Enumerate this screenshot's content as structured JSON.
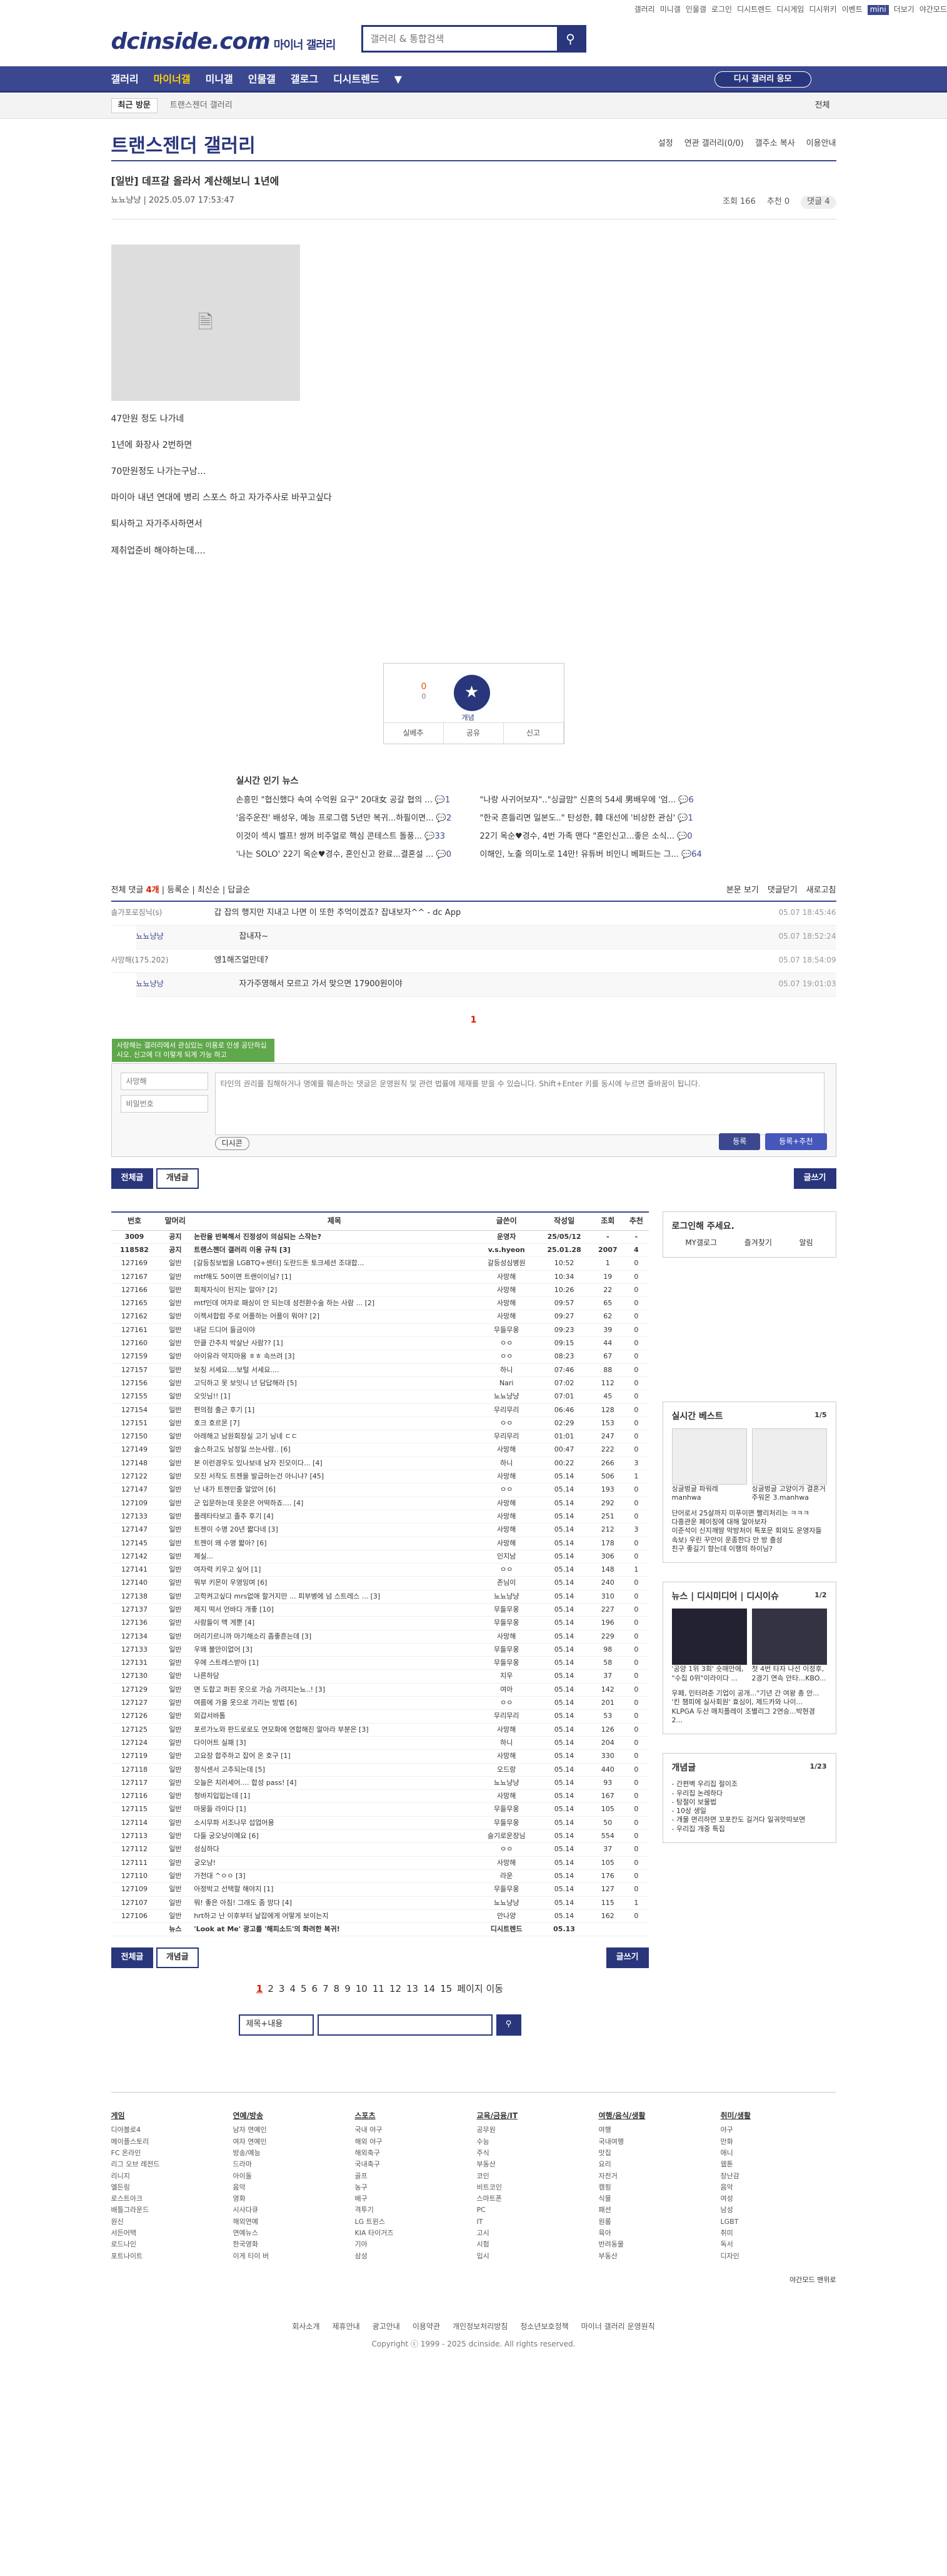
{
  "util": {
    "links": [
      "갤러리",
      "미니갤",
      "인물갤",
      "로그인",
      "디시트렌드",
      "디시게임",
      "디시위키",
      "이벤트",
      "mini",
      "더보기",
      "야간모드"
    ]
  },
  "logo": {
    "name": "dcinside.com",
    "sub": "마이너 갤러리"
  },
  "search": {
    "placeholder": "갤러리 & 통합검색"
  },
  "gnb": {
    "menu": [
      "갤러리",
      "마이너갤",
      "미니갤",
      "인물갤",
      "갤로그",
      "디시트렌드"
    ],
    "visit": "디시 갤러리 응모"
  },
  "sub": {
    "recent": "최근 방문",
    "crumb": "트랜스젠더 갤러리",
    "all": "전체"
  },
  "gallery": {
    "title": "트랜스젠더 갤러리",
    "opts": [
      "설정",
      "연관 갤러리(0/0)",
      "갤주소 복사",
      "이용안내"
    ]
  },
  "post": {
    "title": "[일반] 데프갈 올라서 계산해보니 1년에",
    "author": "뇨뇨냥냥",
    "date": "2025.05.07 17:53:47",
    "views": "조회 166",
    "rec": "추천 0",
    "comments": "댓글 4",
    "body": [
      "47만원 정도 나가네",
      "1년에 화장사 2번하면",
      "70만원정도 나가는구남...",
      "마이아 내년 연대에 병리 스포스 하고 자가주사로 바꾸고싶다",
      "퇴사하고 자가주사하면서",
      "제취업준비 해야하는데...."
    ]
  },
  "vote": {
    "up": "0",
    "up_sub": "0",
    "star": "개념",
    "acts": [
      "실베추",
      "공유",
      "신고"
    ]
  },
  "news": {
    "title": "실시간 인기 뉴스",
    "items": [
      {
        "t": "손흥민 \"협신했다 속여 수억원 요구\" 20대女 공갈 협의 ...",
        "c": "1"
      },
      {
        "t": "\"나랑 사귀어보자\"..\"싱글맘\" 신혼의 54세 男배우에 '엄...",
        "c": "6"
      },
      {
        "t": "'음주운전' 배성우, 예능 프로그램 5년만 복귀...하필이면...",
        "c": "2"
      },
      {
        "t": "\"한국 흔들리면 일본도..\" 탄성한, 韓 대선에 '비상한 관심'",
        "c": "1"
      },
      {
        "t": "이것이 섹시 벨프! 쌍꺼 비주얼로 핵심 콘테스트 돌풍...",
        "c": "33"
      },
      {
        "t": "22기 옥순♥경수, 4번 가족 맨다 \"혼인신고...좋은 소식...",
        "c": "0"
      },
      {
        "t": "'나는 SOLO' 22기 옥순♥경수, 혼인신고 완료...결혼설 ...",
        "c": "0"
      },
      {
        "t": "이해인, 노출 의미노로 14만! 유튜버 비인니 베퍼드는 그...",
        "c": "64"
      }
    ]
  },
  "comments": {
    "total_label": "전체 댓글",
    "count": "4개",
    "sort": [
      "등록순",
      "최신순",
      "답글순"
    ],
    "right": [
      "본문 보기",
      "댓글닫기",
      "새로고침"
    ],
    "list": [
      {
        "nick": "솔가포로짐닉(s)",
        "text": "갑 잡의 행지만 지내고 나면 이 또한 추억이겠죠? 잡내보자^^ - dc App",
        "date": "05.07 18:45:46",
        "reply": false
      },
      {
        "nick": "뇨뇨냥냥",
        "text": "잡내자~",
        "date": "05.07 18:52:24",
        "reply": true
      },
      {
        "nick": "사망해(175.202)",
        "text": "엥1해즈얼만데?",
        "date": "05.07 18:54:09",
        "reply": false
      },
      {
        "nick": "뇨뇨냥냥",
        "text": "자가주영해서 모르고 가서 맞으면 17900원이야",
        "date": "05.07 19:01:03",
        "reply": true
      }
    ]
  },
  "page_one": "1",
  "write": {
    "tip": "사랑해는 갤러리에서 관심있는 이용로 인생 공단하십시오. 신고에 더 이렇게 되게 가능 하고",
    "nick_placeholder": "사망해",
    "pw_placeholder": "비밀번호",
    "body_placeholder": "타인의 권리를 침해하거나 명예를 훼손하는 댓글은 운영원칙 및 관련 법률에 제재를 받을 수 있습니다. Shift+Enter 키를 동시에 누르면 줄바꿈이 됩니다.",
    "dcon": "디시콘",
    "submit": "등록",
    "submit2": "등록+추천"
  },
  "tabs": {
    "all": "전체글",
    "concept": "개념글",
    "write": "글쓰기"
  },
  "table": {
    "headers": [
      "번호",
      "말머리",
      "제목",
      "글쓴이",
      "작성일",
      "조회",
      "추천"
    ],
    "rows": [
      [
        "3009",
        "공지",
        "논란을 반복해서 진정성이 의심되는 스작는?",
        "운영자",
        "25/05/12",
        "-",
        "-"
      ],
      [
        "118582",
        "공지",
        "트랜스젠더 갤러리 이용 규칙 [3]",
        "v.s.hyeon",
        "25.01.28",
        "2007",
        "4"
      ],
      [
        "127169",
        "일반",
        "[갈등칭보법을 LGBTQ+센터] 도란드돈 토크세션 조대합...",
        "갈등성심병원",
        "10:52",
        "1",
        "0"
      ],
      [
        "127167",
        "일반",
        "mtf해도 50이면 트랜이이님? [1]",
        "사망해",
        "10:34",
        "19",
        "0"
      ],
      [
        "127166",
        "일반",
        "회제자식이 된지는 알아? [2]",
        "사망해",
        "10:26",
        "22",
        "0"
      ],
      [
        "127165",
        "일반",
        "mtf인데 여자로 패싱이 안 되는데 성전환수술 하는 사람 ... [2]",
        "사망해",
        "09:57",
        "65",
        "0"
      ],
      [
        "127162",
        "일반",
        "이젝셔합럼 주로 어플하는 어플이 뭐야? [2]",
        "사망해",
        "09:27",
        "62",
        "0"
      ],
      [
        "127161",
        "일반",
        "내담 드디어 들금이야",
        "무들무웅",
        "09:23",
        "39",
        "0"
      ],
      [
        "127160",
        "일반",
        "만클 간추치 박살난 사람?? [1]",
        "ㅇㅇ",
        "09:15",
        "44",
        "0"
      ],
      [
        "127159",
        "일반",
        "아이유라 약지마용 ㅎㅎ 속쓰려 [3]",
        "ㅇㅇ",
        "08:23",
        "67",
        "0"
      ],
      [
        "127157",
        "일반",
        "보징 서세요....보털 서세요....",
        "하니",
        "07:46",
        "88",
        "0"
      ],
      [
        "127156",
        "일반",
        "고딕하고 못 보잇니 넌 담답해라 [5]",
        "Nari",
        "07:02",
        "112",
        "0"
      ],
      [
        "127155",
        "일반",
        "오잇님!! [1]",
        "뇨뇨냥냥",
        "07:01",
        "45",
        "0"
      ],
      [
        "127154",
        "일반",
        "편의점 출근 후기 [1]",
        "무리무리",
        "06:46",
        "128",
        "0"
      ],
      [
        "127151",
        "일반",
        "호크 호르몬 [7]",
        "ㅇㅇ",
        "02:29",
        "153",
        "0"
      ],
      [
        "127150",
        "일반",
        "아레해고 남원회장실 고기 닝네 ㄷㄷ",
        "무리무리",
        "01:01",
        "247",
        "0"
      ],
      [
        "127149",
        "일반",
        "술스하고도 남정일 쓰는사람.. [6]",
        "사망해",
        "00:47",
        "222",
        "0"
      ],
      [
        "127148",
        "일반",
        "본 이런경우도 있나보네 남자 진모이다... [4]",
        "하니",
        "00:22",
        "266",
        "3"
      ],
      [
        "127122",
        "일반",
        "모진 서작도 트젠을 발급하는건 아니냐? [45]",
        "사망해",
        "05.14",
        "506",
        "1"
      ],
      [
        "127147",
        "일반",
        "난 내가 트젠인줄 알았어 [6]",
        "ㅇㅇ",
        "05.14",
        "193",
        "0"
      ],
      [
        "127109",
        "일반",
        "군 입문하는데 옷운은 어떡하죠.... [4]",
        "사망해",
        "05.14",
        "292",
        "0"
      ],
      [
        "127133",
        "일반",
        "플레타타보고 졸추 후기 [4]",
        "사망해",
        "05.14",
        "251",
        "0"
      ],
      [
        "127147",
        "일반",
        "트젠이 수명 20년 짧다네 [3]",
        "사망해",
        "05.14",
        "212",
        "3"
      ],
      [
        "127145",
        "일반",
        "트젠이 왜 수명 짧아? [6]",
        "사망해",
        "05.14",
        "178",
        "0"
      ],
      [
        "127142",
        "일반",
        "제실...",
        "인지남",
        "05.14",
        "306",
        "0"
      ],
      [
        "127141",
        "일반",
        "여자력 키우고 싶어 [1]",
        "ㅇㅇ",
        "05.14",
        "148",
        "1"
      ],
      [
        "127140",
        "일반",
        "뭐부 키몬이 우영잉며 [6]",
        "존님이",
        "05.14",
        "240",
        "0"
      ],
      [
        "127138",
        "일반",
        "고학켜고싶다 mrs없애 할거지만 ... 피부병에 넘 스트레스 ... [3]",
        "뇨뇨냥냥",
        "05.14",
        "310",
        "0"
      ],
      [
        "127137",
        "일반",
        "제지 떡서 언바다 개좋 [10]",
        "무들무웅",
        "05.14",
        "227",
        "0"
      ],
      [
        "127136",
        "일반",
        "사람들이 맥 게뿐 [4]",
        "무들무웅",
        "05.14",
        "196",
        "0"
      ],
      [
        "127134",
        "일반",
        "머리기르니까 마기해소리 좀좋흔는데 [3]",
        "사망해",
        "05.14",
        "229",
        "0"
      ],
      [
        "127133",
        "일반",
        "우왜 불안이없어 [3]",
        "무들무웅",
        "05.14",
        "98",
        "0"
      ],
      [
        "127131",
        "일반",
        "우에 스트레스받아 [1]",
        "무들무웅",
        "05.14",
        "58",
        "0"
      ],
      [
        "127130",
        "일반",
        "나른하당",
        "지우",
        "05.14",
        "37",
        "0"
      ],
      [
        "127129",
        "일반",
        "면 도합고 퍼핀 옷으로 가슴 가려지는뇨..! [3]",
        "여아",
        "05.14",
        "142",
        "0"
      ],
      [
        "127127",
        "일반",
        "여름에 가을 옷으로 가리는 방법 [6]",
        "ㅇㅇ",
        "05.14",
        "201",
        "0"
      ],
      [
        "127126",
        "일반",
        "외갑서바톰",
        "무리무리",
        "05.14",
        "53",
        "0"
      ],
      [
        "127125",
        "일반",
        "포르가노와 판드로로도 연모화에 연합해진 알아라 부분은 [3]",
        "사망해",
        "05.14",
        "126",
        "0"
      ],
      [
        "127124",
        "일반",
        "다이어트 실패 [3]",
        "하니",
        "05.14",
        "204",
        "0"
      ],
      [
        "127119",
        "일반",
        "고요장 합주하고 잡어 온 호구 [1]",
        "사망해",
        "05.14",
        "330",
        "0"
      ],
      [
        "127118",
        "일반",
        "정식센서 고추되는데 [5]",
        "오드랑",
        "05.14",
        "440",
        "0"
      ],
      [
        "127117",
        "일반",
        "오늘은 치러세어.... 합성 pass! [4]",
        "뇨뇨냥냥",
        "05.14",
        "93",
        "0"
      ],
      [
        "127116",
        "일반",
        "청바지입입는데 [1]",
        "사망해",
        "05.14",
        "167",
        "0"
      ],
      [
        "127115",
        "일반",
        "마뭉들 라이다 [1]",
        "무들무웅",
        "05.14",
        "105",
        "0"
      ],
      [
        "127114",
        "일반",
        "소시무파 서조나무 섭업어용",
        "무들무웅",
        "05.14",
        "50",
        "0"
      ],
      [
        "127113",
        "일반",
        "다들 궁오냥이예요 [6]",
        "슬기로운장님",
        "05.14",
        "554",
        "0"
      ],
      [
        "127112",
        "일반",
        "성심하다",
        "ㅇㅇ",
        "05.14",
        "37",
        "0"
      ],
      [
        "127111",
        "일반",
        "궁오냥!",
        "사망해",
        "05.14",
        "105",
        "0"
      ],
      [
        "127110",
        "일반",
        "가천대 ^ㅇㅇ [3]",
        "라운",
        "05.14",
        "176",
        "0"
      ],
      [
        "127109",
        "일반",
        "아정박고 선택할 해야지 [1]",
        "무들무웅",
        "05.14",
        "127",
        "0"
      ],
      [
        "127107",
        "일반",
        "뭐! 좋은 아침! 그래도 좀 망다 [4]",
        "뇨뇨냥냥",
        "05.14",
        "115",
        "1"
      ],
      [
        "127106",
        "일반",
        "hrt하고 난 이후부터 날잡에게 어떻게 보이는지",
        "안나양",
        "05.14",
        "162",
        "0"
      ],
      [
        "",
        "뉴스",
        "'Look at Me' 광고를 '해피소드'의 화려한 복귀!",
        "디시트렌드",
        "05.13",
        "",
        ""
      ]
    ]
  },
  "sidebar": {
    "login": "로그인해 주세요.",
    "login_btns": [
      "MY갤로그",
      "즐겨찾기",
      "알림"
    ],
    "best_title": "실시간 베스트",
    "best_page": "1/5",
    "best_items": [
      "싱글벙글 파워레 manhwa",
      "싱글벙글 고양이가 결혼거 주워온 3.manhwa"
    ],
    "best_list": [
      "단어로서 25살까지 미푸이면 빨리처리는 ㅋㅋㅋ",
      "다흥관운 페이징에 대해 알아보자",
      "이준석이 신지깨땅 막방처이 특포문 회외도 운영자들",
      "속보) 우린 꾸안이 운종한다 안 방 출성",
      "친구 좋길기 향는데 이행의 하이닝?"
    ],
    "news_title": "뉴스 | 디시미디어 | 디시이슈",
    "news_page": "1/2",
    "news_items": [
      "'공양 1위 3회' 숏매만에, \"수집 0위\"이라이다 ...",
      "첫 4번 타자 나선 이정후, 2경기 연속 안타…KBO..."
    ],
    "news_list": [
      "우페, 민터려준 기업이 공개...\"기년 간 여왕 총 안...",
      "'킨 챔피에 실사회원' 효심이, 제드카와 나이...",
      "KLPGA 두산 매치플레이 조별리그 2연승...박현경 2..."
    ],
    "concept_title": "개념글",
    "concept_page": "1/23",
    "concept_list": [
      "- 간편벽 우리집 절이조",
      "- 우리집 논레하다",
      "- 탕절이 보물법",
      "- 10상 생일",
      "- 개물 면리하면 꼬포칸도 길거다 일궈맛따보면",
      "- 우리집 개중 특집"
    ]
  },
  "pager": {
    "pages": [
      "1",
      "2",
      "3",
      "4",
      "5",
      "6",
      "7",
      "8",
      "9",
      "10",
      "11",
      "12",
      "13",
      "14",
      "15"
    ],
    "jump": "페이지 이동"
  },
  "bsearch": {
    "select": "제목+내용"
  },
  "footer": {
    "cols": [
      {
        "h": "게임",
        "items": [
          "디아블로4",
          "메이플스토리",
          "FC 온라인",
          "리그 오브 레전드",
          "리니지",
          "엘든링",
          "로스트아크",
          "배틀그라운드",
          "원신",
          "서든어택",
          "로드나인",
          "포트나이트"
        ]
      },
      {
        "h": "연예/방송",
        "items": [
          "남자 연예인",
          "여자 연예인",
          "방송/예능",
          "드라마",
          "아이돌",
          "음악",
          "영화",
          "시사다큐",
          "해외연예",
          "연예뉴스",
          "한국영화",
          "이게 티이 버"
        ]
      },
      {
        "h": "스포츠",
        "items": [
          "국내 야구",
          "해외 야구",
          "해외축구",
          "국내축구",
          "골프",
          "농구",
          "배구",
          "격투기",
          "LG 트윈스",
          "KIA 타이거즈",
          "기아",
          "삼성"
        ]
      },
      {
        "h": "교육/금융/IT",
        "items": [
          "공무원",
          "수능",
          "주식",
          "부동산",
          "코인",
          "비트코인",
          "스마트폰",
          "PC",
          "IT",
          "고시",
          "시험",
          "입시"
        ]
      },
      {
        "h": "여행/음식/생활",
        "items": [
          "여행",
          "국내여행",
          "맛집",
          "요리",
          "자전거",
          "캠핑",
          "식물",
          "패션",
          "원룸",
          "육아",
          "반려동물",
          "부동산"
        ]
      },
      {
        "h": "취미/생활",
        "items": [
          "야구",
          "만화",
          "애니",
          "웹툰",
          "장난감",
          "음악",
          "여성",
          "남성",
          "LGBT",
          "취미",
          "독서",
          "디자인"
        ]
      }
    ],
    "mini": [
      "야간모드",
      "맨위로"
    ],
    "links": [
      "회사소개",
      "제휴안내",
      "광고안내",
      "이용약관",
      "개인정보처리방침",
      "청소년보호정책",
      "마이너 갤러리 운영원칙"
    ],
    "copyright": "Copyright ⓒ 1999 - 2025 dcinside. All rights reserved."
  }
}
